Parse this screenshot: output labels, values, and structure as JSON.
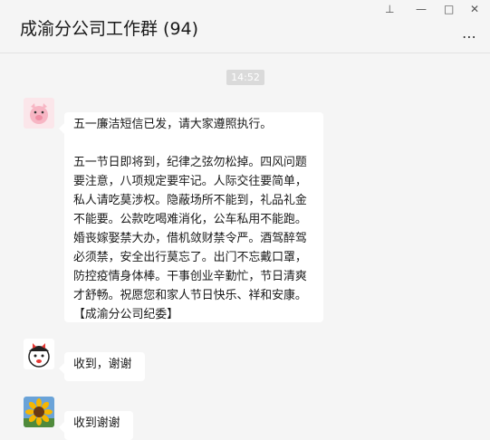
{
  "header": {
    "title": "成渝分公司工作群 (94)",
    "pin_glyph": "⊥",
    "minimize_glyph": "—",
    "maximize_glyph": "□",
    "close_glyph": "✕",
    "more_glyph": "⋯"
  },
  "timestamp": "14:52",
  "messages": [
    {
      "avatar_icon": "pig-avatar-icon",
      "text": "五一廉洁短信已发，请大家遵照执行。\n\n五一节日即将到，纪律之弦勿松掉。四风问题要注意，八项规定要牢记。人际交往要简单，私人请吃莫涉权。隐蔽场所不能到，礼品礼金不能要。公款吃喝难消化，公车私用不能跑。婚丧嫁娶禁大办，借机敛财禁令严。酒驾醉驾必须禁，安全出行莫忘了。出门不忘戴口罩，防控疫情身体棒。干事创业辛勤忙，节日清爽才舒畅。祝愿您和家人节日快乐、祥和安康。【成渝分公司纪委】"
    },
    {
      "avatar_icon": "cartoon-girl-avatar-icon",
      "text": "收到，谢谢"
    },
    {
      "avatar_icon": "sunflower-avatar-icon",
      "text": "收到谢谢"
    }
  ],
  "colors": {
    "background": "#f5f5f5",
    "bubble": "#ffffff",
    "time_badge": "#dadada"
  }
}
